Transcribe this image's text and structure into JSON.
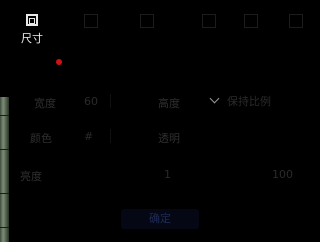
{
  "toolbar": {
    "size_label": "尺寸",
    "items": [
      "",
      "",
      "",
      "",
      "",
      ""
    ]
  },
  "form": {
    "row1": {
      "label": "宽度",
      "value": "60",
      "mid_label": "高度",
      "select_value": "保持比例"
    },
    "row2": {
      "label": "颜色",
      "value": "#",
      "mid_label": "透明"
    },
    "row3": {
      "label": "亮度",
      "mid_value": "1",
      "right_value": "100"
    }
  },
  "confirm_label": "确定",
  "colors": {
    "background": "#000000",
    "active_icon": "#e8e8e8",
    "indicator": "#d01212",
    "button": "#050814"
  }
}
